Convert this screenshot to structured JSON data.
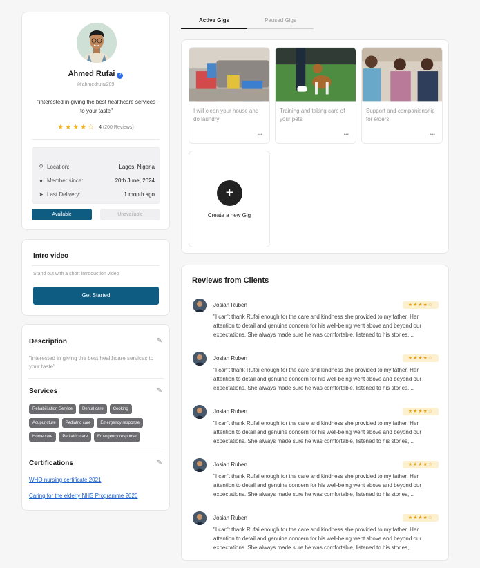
{
  "profile": {
    "name": "Ahmed Rufai",
    "handle": "@ahmedrufai209",
    "tagline": "\"interested in giving the best healthcare services to your taste\"",
    "rating_value": "4",
    "rating_count": "(200 Reviews)",
    "rating_stars": 4,
    "location_label": "Location:",
    "location_value": "Lagos, Nigeria",
    "member_label": "Member since:",
    "member_value": "20th June, 2024",
    "delivery_label": "Last Delivery:",
    "delivery_value": "1 month ago",
    "available_label": "Available",
    "unavailable_label": "Unavailable",
    "accent": "#0f5c82"
  },
  "intro": {
    "title": "Intro video",
    "subtitle": "Stand out with a short introduction video",
    "button": "Get Started"
  },
  "details": {
    "description_title": "Description",
    "description_text": "\"interested in giving the best healthcare services to your taste\"",
    "services_title": "Services",
    "services_rows": [
      [
        "Rehabilitation Service",
        "Dental care",
        "Cooking"
      ],
      [
        "Acupuncture",
        "Pediatric care",
        "Emergency response"
      ],
      [
        "Home care",
        "Pediatric care",
        "Emergency response"
      ]
    ],
    "certifications_title": "Certifications",
    "certifications": [
      "WHO nursing certificate 2021",
      "Caring for the elderly NHS Programme 2020"
    ]
  },
  "tabs": {
    "active": "Active Gigs",
    "paused": "Paused Gigs"
  },
  "gigs": {
    "items": [
      {
        "title": "I will clean your house and do laundry"
      },
      {
        "title": "Training and taking care of your pets"
      },
      {
        "title": "Support and companionship for elders"
      }
    ],
    "more": "•••",
    "create_label": "Create a new Gig",
    "create_icon": "+"
  },
  "reviews": {
    "title": "Reviews from Clients",
    "items": [
      {
        "name": "Josiah Ruben",
        "stars": 4,
        "text": "\"I can't thank Rufai enough for the care and kindness she provided to my father. Her attention to detail and genuine concern for his well-being went above and beyond our expectations. She always made sure he was comfortable, listened to his stories,..."
      },
      {
        "name": "Josiah Ruben",
        "stars": 4,
        "text": "\"I can't thank Rufai enough for the care and kindness she provided to my father. Her attention to detail and genuine concern for his well-being went above and beyond our expectations. She always made sure he was comfortable, listened to his stories,..."
      },
      {
        "name": "Josiah Ruben",
        "stars": 4,
        "text": "\"I can't thank Rufai enough for the care and kindness she provided to my father. Her attention to detail and genuine concern for his well-being went above and beyond our expectations. She always made sure he was comfortable, listened to his stories,..."
      },
      {
        "name": "Josiah Ruben",
        "stars": 4,
        "text": "\"I can't thank Rufai enough for the care and kindness she provided to my father. Her attention to detail and genuine concern for his well-being went above and beyond our expectations. She always made sure he was comfortable, listened to his stories,..."
      },
      {
        "name": "Josiah Ruben",
        "stars": 4,
        "text": "\"I can't thank Rufai enough for the care and kindness she provided to my father. Her attention to detail and genuine concern for his well-being went above and beyond our expectations. She always made sure he was comfortable, listened to his stories,..."
      }
    ]
  }
}
